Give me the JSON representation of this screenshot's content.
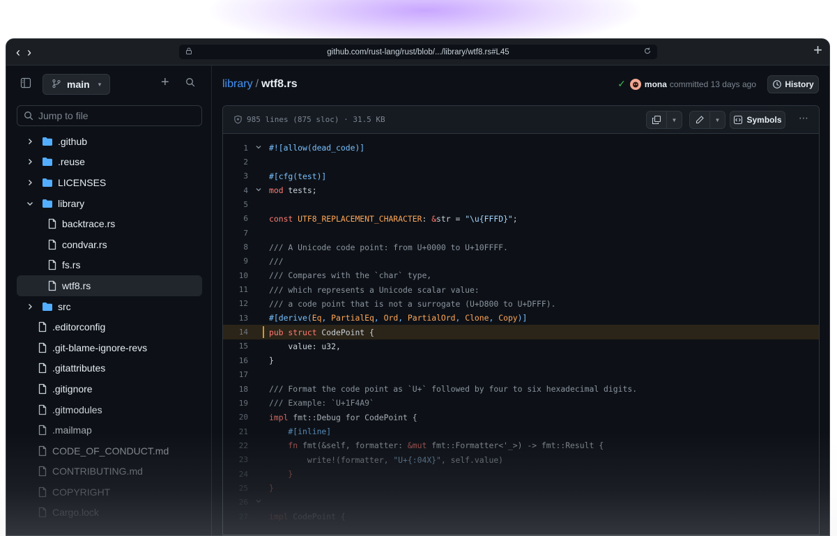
{
  "browser": {
    "url": "github.com/rust-lang/rust/blob/.../library/wtf8.rs#L45"
  },
  "sidebar": {
    "branch": "main",
    "search_placeholder": "Jump to file",
    "items": [
      {
        "label": ".github",
        "type": "folder",
        "state": "collapsed",
        "level": 0
      },
      {
        "label": ".reuse",
        "type": "folder",
        "state": "collapsed",
        "level": 0
      },
      {
        "label": "LICENSES",
        "type": "folder",
        "state": "collapsed",
        "level": 0
      },
      {
        "label": "library",
        "type": "folder",
        "state": "expanded",
        "level": 0
      },
      {
        "label": "backtrace.rs",
        "type": "file",
        "level": 1
      },
      {
        "label": "condvar.rs",
        "type": "file",
        "level": 1
      },
      {
        "label": "fs.rs",
        "type": "file",
        "level": 1
      },
      {
        "label": "wtf8.rs",
        "type": "file",
        "level": 1,
        "selected": true
      },
      {
        "label": "src",
        "type": "folder",
        "state": "collapsed",
        "level": 0
      },
      {
        "label": ".editorconfig",
        "type": "file",
        "level": 0
      },
      {
        "label": ".git-blame-ignore-revs",
        "type": "file",
        "level": 0
      },
      {
        "label": ".gitattributes",
        "type": "file",
        "level": 0
      },
      {
        "label": ".gitignore",
        "type": "file",
        "level": 0
      },
      {
        "label": ".gitmodules",
        "type": "file",
        "level": 0
      },
      {
        "label": ".mailmap",
        "type": "file",
        "level": 0
      },
      {
        "label": "CODE_OF_CONDUCT.md",
        "type": "file",
        "level": 0
      },
      {
        "label": "CONTRIBUTING.md",
        "type": "file",
        "level": 0
      },
      {
        "label": "COPYRIGHT",
        "type": "file",
        "level": 0
      },
      {
        "label": "Cargo.lock",
        "type": "file",
        "level": 0
      }
    ]
  },
  "header": {
    "breadcrumb_dir": "library",
    "breadcrumb_sep": "/",
    "breadcrumb_file": "wtf8.rs",
    "commit_user": "mona",
    "commit_text": "committed 13 days ago",
    "history_label": "History"
  },
  "file": {
    "info": "985 lines (875 sloc) · 31.5 KB",
    "symbols_label": "Symbols",
    "highlighted_line": 14
  },
  "code_lines": [
    {
      "n": "1",
      "fold": true,
      "tokens": [
        [
          "at",
          "#![allow(dead_code)]"
        ]
      ]
    },
    {
      "n": "2",
      "tokens": []
    },
    {
      "n": "3",
      "tokens": [
        [
          "at",
          "#[cfg(test)]"
        ]
      ]
    },
    {
      "n": "4",
      "fold": true,
      "tokens": [
        [
          "kw",
          "mod"
        ],
        [
          "tx",
          " tests;"
        ]
      ]
    },
    {
      "n": "5",
      "tokens": []
    },
    {
      "n": "6",
      "tokens": [
        [
          "kw",
          "const"
        ],
        [
          "tx",
          " "
        ],
        [
          "ty",
          "UTF8_REPLACEMENT_CHARACTER"
        ],
        [
          "tx",
          ": "
        ],
        [
          "kw",
          "&"
        ],
        [
          "tx",
          "str = "
        ],
        [
          "st",
          "\"\\u{FFFD}\""
        ],
        [
          "tx",
          ";"
        ]
      ]
    },
    {
      "n": "7",
      "tokens": []
    },
    {
      "n": "8",
      "tokens": [
        [
          "cm",
          "/// A Unicode code point: from U+0000 to U+10FFFF."
        ]
      ]
    },
    {
      "n": "9",
      "tokens": [
        [
          "cm",
          "///"
        ]
      ]
    },
    {
      "n": "10",
      "tokens": [
        [
          "cm",
          "/// Compares with the `char` type,"
        ]
      ]
    },
    {
      "n": "11",
      "tokens": [
        [
          "cm",
          "/// which represents a Unicode scalar value:"
        ]
      ]
    },
    {
      "n": "12",
      "tokens": [
        [
          "cm",
          "/// a code point that is not a surrogate (U+D800 to U+DFFF)."
        ]
      ]
    },
    {
      "n": "13",
      "tokens": [
        [
          "at",
          "#[derive("
        ],
        [
          "ty",
          "Eq"
        ],
        [
          "at",
          ", "
        ],
        [
          "ty",
          "PartialEq"
        ],
        [
          "at",
          ", "
        ],
        [
          "ty",
          "Ord"
        ],
        [
          "at",
          ", "
        ],
        [
          "ty",
          "PartialOrd"
        ],
        [
          "at",
          ", "
        ],
        [
          "ty",
          "Clone"
        ],
        [
          "at",
          ", "
        ],
        [
          "ty",
          "Copy"
        ],
        [
          "at",
          ")]"
        ]
      ]
    },
    {
      "n": "14",
      "tokens": [
        [
          "kw",
          "pub struct"
        ],
        [
          "tx",
          " CodePoint {"
        ]
      ]
    },
    {
      "n": "15",
      "tokens": [
        [
          "tx",
          "    value: u32,"
        ]
      ]
    },
    {
      "n": "16",
      "tokens": [
        [
          "tx",
          "}"
        ]
      ]
    },
    {
      "n": "17",
      "tokens": []
    },
    {
      "n": "18",
      "tokens": [
        [
          "cm",
          "/// Format the code point as `U+` followed by four to six hexadecimal digits."
        ]
      ]
    },
    {
      "n": "19",
      "tokens": [
        [
          "cm",
          "/// Example: `U+1F4A9`"
        ]
      ]
    },
    {
      "n": "20",
      "tokens": [
        [
          "kw",
          "impl"
        ],
        [
          "tx",
          " fmt::Debug for CodePoint {"
        ]
      ]
    },
    {
      "n": "21",
      "tokens": [
        [
          "at",
          "    #[inline]"
        ]
      ]
    },
    {
      "n": "22",
      "tokens": [
        [
          "kw",
          "    fn"
        ],
        [
          "tx",
          " fmt(&self, formatter: "
        ],
        [
          "kw",
          "&mut"
        ],
        [
          "tx",
          " fmt::Formatter<'_>) -> fmt::Result {"
        ]
      ]
    },
    {
      "n": "23",
      "tokens": [
        [
          "tx",
          "        write!(formatter, "
        ],
        [
          "st",
          "\"U+{:04X}\""
        ],
        [
          "tx",
          ", self.value)"
        ]
      ]
    },
    {
      "n": "24",
      "tokens": [
        [
          "kw",
          "    }"
        ]
      ]
    },
    {
      "n": "25",
      "tokens": [
        [
          "kw",
          "}"
        ]
      ]
    },
    {
      "n": "26",
      "fold": true,
      "tokens": []
    },
    {
      "n": "27",
      "tokens": [
        [
          "kw",
          "impl"
        ],
        [
          "tx",
          " CodePoint {"
        ]
      ]
    }
  ]
}
